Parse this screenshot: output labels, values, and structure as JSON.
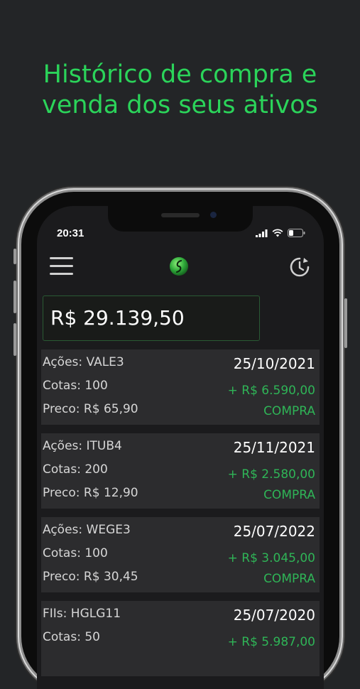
{
  "headline": {
    "line1": "Histórico de compra e",
    "line2": "venda dos seus ativos"
  },
  "status_bar": {
    "time": "20:31",
    "icons": [
      "signal-icon",
      "wifi-icon",
      "battery-icon"
    ]
  },
  "app_bar": {
    "menu_icon": "hamburger-menu-icon",
    "logo_icon": "app-logo-icon",
    "refresh_icon": "history-refresh-icon"
  },
  "balance": {
    "value": "R$ 29.139,50"
  },
  "transactions": [
    {
      "asset": "Ações: VALE3",
      "quota": "Cotas: 100",
      "price": "Preco: R$ 65,90",
      "date": "25/10/2021",
      "amount": "+ R$ 6.590,00",
      "type": "COMPRA"
    },
    {
      "asset": "Ações: ITUB4",
      "quota": "Cotas: 200",
      "price": "Preco: R$ 12,90",
      "date": "25/11/2021",
      "amount": "+ R$ 2.580,00",
      "type": "COMPRA"
    },
    {
      "asset": "Ações: WEGE3",
      "quota": "Cotas: 100",
      "price": "Preco: R$ 30,45",
      "date": "25/07/2022",
      "amount": "+ R$ 3.045,00",
      "type": "COMPRA"
    },
    {
      "asset": "FIIs: HGLG11",
      "quota": "Cotas: 50",
      "price": "",
      "date": "25/07/2020",
      "amount": "+ R$ 5.987,00",
      "type": ""
    }
  ],
  "colors": {
    "background": "#232527",
    "accent": "#2bd45a",
    "positive": "#2fb557",
    "card": "#2c2c2e",
    "screen": "#1b1b1d"
  }
}
